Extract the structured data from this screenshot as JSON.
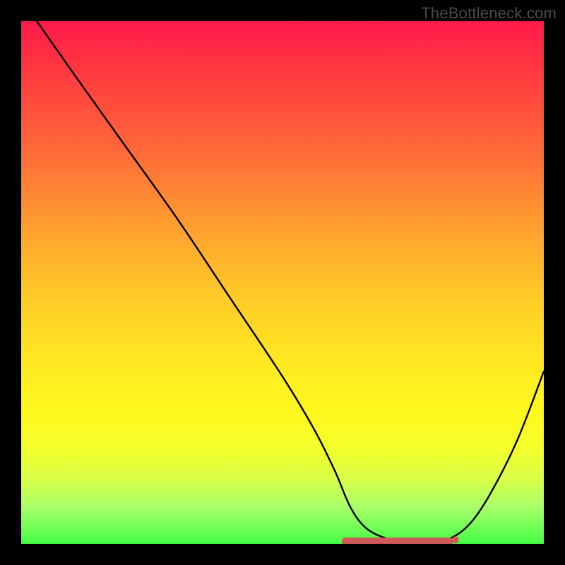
{
  "watermark": "TheBottleneck.com",
  "chart_data": {
    "type": "line",
    "title": "",
    "xlabel": "",
    "ylabel": "",
    "xlim": [
      0,
      100
    ],
    "ylim": [
      0,
      100
    ],
    "series": [
      {
        "name": "curve",
        "x": [
          3,
          10,
          20,
          30,
          40,
          50,
          56,
          60,
          63,
          66,
          70,
          74,
          78,
          82,
          86,
          90,
          95,
          100
        ],
        "y": [
          100,
          90,
          76,
          62,
          47,
          32,
          22,
          14,
          7,
          3,
          1,
          0.5,
          0.5,
          1,
          4,
          10,
          20,
          33
        ]
      }
    ],
    "optimal_band": {
      "x_start": 62,
      "x_end": 82,
      "y": 0.5
    },
    "colors": {
      "curve": "#000000",
      "band": "#d05a5a",
      "gradient_top": "#ff1a4a",
      "gradient_bottom": "#45ff45"
    }
  }
}
